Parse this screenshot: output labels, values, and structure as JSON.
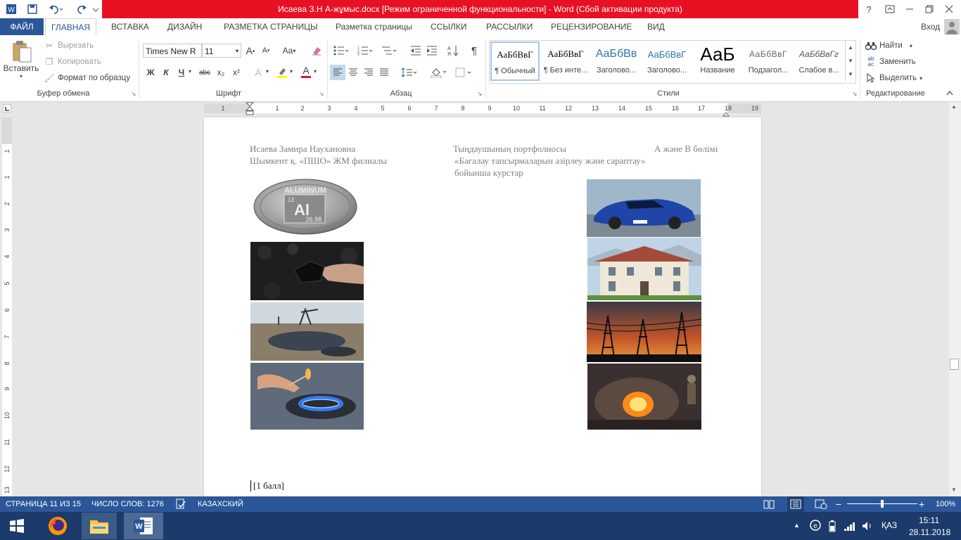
{
  "window": {
    "title": "Исаева З.Н  А-жұмыс.docx [Режим ограниченной функциональности] -  Word (Сбой активации продукта)",
    "help_icon": "?",
    "signin": "Вход"
  },
  "tabs": {
    "file": "ФАЙЛ",
    "items": [
      "ГЛАВНАЯ",
      "ВСТАВКА",
      "ДИЗАЙН",
      "РАЗМЕТКА СТРАНИЦЫ",
      "Разметка страницы",
      "ССЫЛКИ",
      "РАССЫЛКИ",
      "РЕЦЕНЗИРОВАНИЕ",
      "ВИД"
    ]
  },
  "ribbon": {
    "clipboard": {
      "paste": "Вставить",
      "cut": "Вырезать",
      "copy": "Копировать",
      "format_painter": "Формат по образцу",
      "label": "Буфер обмена"
    },
    "font": {
      "font_name": "Times New R",
      "font_size": "11",
      "label": "Шрифт",
      "bold": "Ж",
      "italic": "К",
      "underline": "Ч",
      "strike": "abc",
      "subscript": "x₂",
      "superscript": "x²",
      "grow": "A",
      "shrink": "A",
      "case": "Aa",
      "text_effects": "A",
      "font_color": "A"
    },
    "paragraph": {
      "label": "Абзац",
      "pilcrow": "¶"
    },
    "styles": {
      "label": "Стили",
      "items": [
        {
          "sample": "АаБбВвГ",
          "name": "¶ Обычный"
        },
        {
          "sample": "АаБбВвГ",
          "name": "¶ Без инте..."
        },
        {
          "sample": "АаБбВв",
          "name": "Заголово..."
        },
        {
          "sample": "АаБбВвГ",
          "name": "Заголово..."
        },
        {
          "sample": "АаБ",
          "name": "Название"
        },
        {
          "sample": "АаБбВвГ",
          "name": "Подзагол..."
        },
        {
          "sample": "АаБбВвГг",
          "name": "Слабое в..."
        }
      ]
    },
    "editing": {
      "label": "Редактирование",
      "find": "Найти",
      "replace": "Заменить",
      "select": "Выделить"
    }
  },
  "ruler": {
    "h_numbers": [
      "1",
      "1",
      "2",
      "3",
      "4",
      "5",
      "6",
      "7",
      "8",
      "9",
      "10",
      "11",
      "12",
      "13",
      "14",
      "15",
      "16",
      "17",
      "18",
      "19"
    ],
    "v_numbers": [
      "1",
      "1",
      "2",
      "3",
      "4",
      "5",
      "6",
      "7",
      "8",
      "9",
      "10",
      "11",
      "12",
      "13",
      "14"
    ]
  },
  "document": {
    "header_left_1": "Исаева Замира Наухановна",
    "header_left_2": "Шымкент қ. «ПШО» ЖМ филиалы",
    "header_center_1": "Тыңдаушының портфолиосы",
    "header_center_2": "«Бағалау тапсырмаларын әзірлеу және сараптау»",
    "header_center_3": "бойынша курстар",
    "header_right_1": "А және В бөлімі",
    "coin_element": "ALUMINUM",
    "coin_symbol": "Al",
    "coin_number": "13",
    "coin_mass": "26.98",
    "body_text": "[1 балл]"
  },
  "statusbar": {
    "page": "СТРАНИЦА 11 ИЗ 15",
    "words": "ЧИСЛО СЛОВ: 1276",
    "language": "КАЗАХСКИЙ",
    "zoom": "100%",
    "zoom_level_percent": 100
  },
  "taskbar": {
    "lang": "ҚАЗ",
    "time": "15:11",
    "date": "28.11.2018"
  },
  "colors": {
    "accent": "#2b579a",
    "titlebar_red": "#e81123"
  }
}
